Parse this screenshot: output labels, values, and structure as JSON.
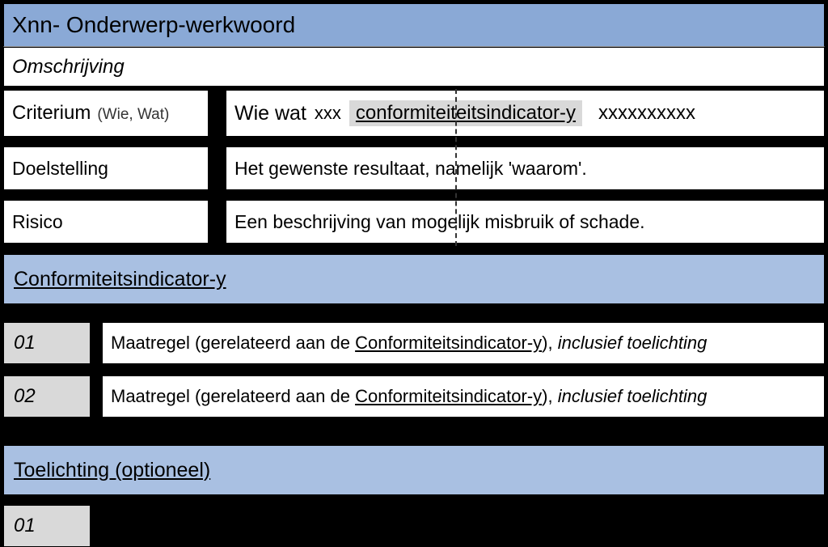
{
  "header": {
    "title": "Xnn- Onderwerp-werkwoord",
    "omschrijving": "Omschrijving"
  },
  "rows": {
    "criterium_label": "Criterium",
    "criterium_sub": "(Wie, Wat)",
    "criterium_pre": "Wie wat",
    "criterium_xxx": "xxx",
    "criterium_highlight": "conformiteiteitsindicator-y",
    "criterium_after": "xxxxxxxxxx",
    "doelstelling_label": "Doelstelling",
    "doelstelling_value": "Het gewenste resultaat, namelijk 'waarom'.",
    "risico_label": "Risico",
    "risico_value": "Een beschrijving van mogelijk misbruik of schade."
  },
  "sections": {
    "indicator_heading": "Conformiteitsindicator-y",
    "toelichting_heading": "Toelichting (optioneel)"
  },
  "measures": {
    "n01": "01",
    "n02": "02",
    "n03": "01",
    "text_pre": "Maatregel (gerelateerd aan de ",
    "text_link": "Conformiteitsindicator-y",
    "text_mid": "), ",
    "text_italic": "inclusief toelichting"
  }
}
